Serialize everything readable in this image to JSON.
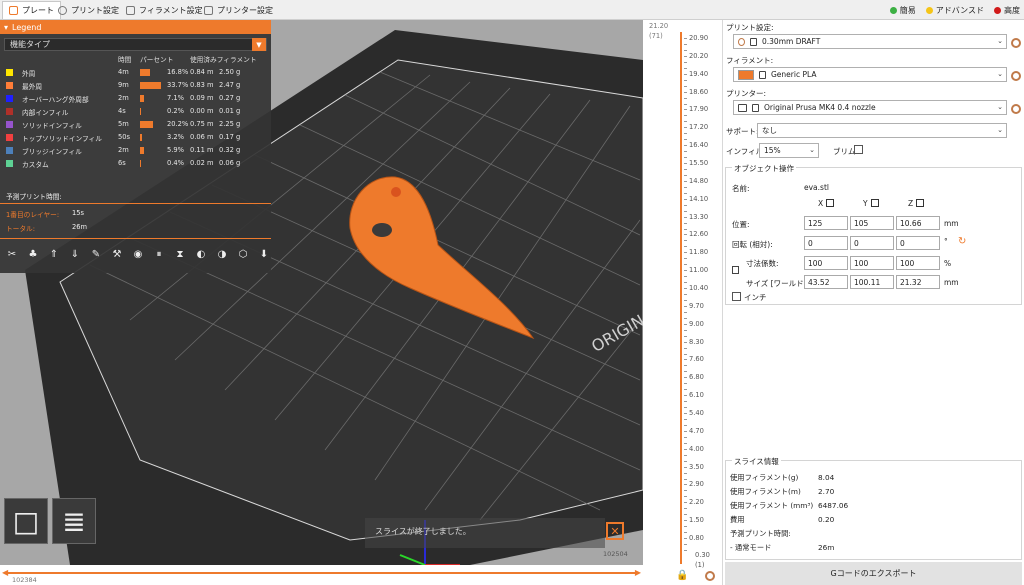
{
  "tabs": [
    {
      "label": "プレート",
      "active": true
    },
    {
      "label": "プリント設定",
      "active": false
    },
    {
      "label": "フィラメント設定",
      "active": false
    },
    {
      "label": "プリンター設定",
      "active": false
    }
  ],
  "modes": [
    {
      "label": "簡易",
      "color": "#3cb043"
    },
    {
      "label": "アドバンスド",
      "color": "#f5c518"
    },
    {
      "label": "高度",
      "color": "#d11a1a"
    }
  ],
  "legend": {
    "title": "Legend",
    "selector": "機能タイプ",
    "columns": {
      "time": "時間",
      "percent": "パーセント",
      "used": "使用済みフィラメント"
    },
    "rows": [
      {
        "name": "外周",
        "color": "#ffe600",
        "time": "4m",
        "percent": "16.8%",
        "pct": 0.168,
        "meters": "0.84 m",
        "grams": "2.50 g"
      },
      {
        "name": "最外周",
        "color": "#ff7d38",
        "time": "9m",
        "percent": "33.7%",
        "pct": 0.337,
        "meters": "0.83 m",
        "grams": "2.47 g"
      },
      {
        "name": "オーバーハング外周部",
        "color": "#1f1fff",
        "time": "2m",
        "percent": "7.1%",
        "pct": 0.071,
        "meters": "0.09 m",
        "grams": "0.27 g"
      },
      {
        "name": "内部インフィル",
        "color": "#b03029",
        "time": "4s",
        "percent": "0.2%",
        "pct": 0.002,
        "meters": "0.00 m",
        "grams": "0.01 g"
      },
      {
        "name": "ソリッドインフィル",
        "color": "#9654cc",
        "time": "5m",
        "percent": "20.2%",
        "pct": 0.202,
        "meters": "0.75 m",
        "grams": "2.25 g"
      },
      {
        "name": "トップソリッドインフィル",
        "color": "#f04040",
        "time": "50s",
        "percent": "3.2%",
        "pct": 0.032,
        "meters": "0.06 m",
        "grams": "0.17 g"
      },
      {
        "name": "ブリッジインフィル",
        "color": "#4d80ba",
        "time": "2m",
        "percent": "5.9%",
        "pct": 0.059,
        "meters": "0.11 m",
        "grams": "0.32 g"
      },
      {
        "name": "カスタム",
        "color": "#5ed194",
        "time": "6s",
        "percent": "0.4%",
        "pct": 0.004,
        "meters": "0.02 m",
        "grams": "0.06 g"
      }
    ],
    "estimated_title": "予測プリント時間:",
    "first_layer_label": "1番目のレイヤー:",
    "first_layer_value": "15s",
    "total_label": "トータル:",
    "total_value": "26m"
  },
  "toast": "スライスが終了しました。",
  "slider": {
    "top_height": "21.20",
    "top_layer": "(71)",
    "bottom_height": "0.30",
    "bottom_layer": "(1)",
    "ticks": [
      "20.90",
      "20.20",
      "19.40",
      "18.60",
      "17.90",
      "17.20",
      "16.40",
      "15.50",
      "14.80",
      "14.10",
      "13.30",
      "12.60",
      "11.80",
      "11.00",
      "10.40",
      "9.70",
      "9.00",
      "8.30",
      "7.60",
      "6.80",
      "6.10",
      "5.40",
      "4.70",
      "4.00",
      "3.50",
      "2.90",
      "2.20",
      "1.50",
      "0.80"
    ],
    "h_left": "102384",
    "h_right": "102504"
  },
  "panel": {
    "print_label": "プリント設定:",
    "print_value": "0.30mm DRAFT",
    "filament_label": "フィラメント:",
    "filament_value": "Generic PLA",
    "filament_color": "#ee7a2c",
    "printer_label": "プリンター:",
    "printer_value": "Original Prusa MK4 0.4 nozzle",
    "support_label": "サポート:",
    "support_value": "なし",
    "infill_label": "インフィル:",
    "infill_value": "15%",
    "brim_label": "ブリム:",
    "object_title": "オブジェクト操作",
    "name_label": "名前:",
    "name_value": "eva.stl",
    "axis_x": "X",
    "axis_y": "Y",
    "axis_z": "Z",
    "position_label": "位置:",
    "position": [
      "125",
      "105",
      "10.66"
    ],
    "position_unit": "mm",
    "rotation_label": "回転 (相対):",
    "rotation": [
      "0",
      "0",
      "0"
    ],
    "rotation_unit": "°",
    "scale_label": "寸法係数:",
    "scale": [
      "100",
      "100",
      "100"
    ],
    "scale_unit": "%",
    "size_label": "サイズ [ワールド]:",
    "size": [
      "43.52",
      "100.11",
      "21.32"
    ],
    "size_unit": "mm",
    "inch_label": "インチ",
    "slice_title": "スライス情報",
    "slice_rows": [
      {
        "label": "使用フィラメント(g)",
        "value": "8.04"
      },
      {
        "label": "使用フィラメント(m)",
        "value": "2.70"
      },
      {
        "label": "使用フィラメント (mm³)",
        "value": "6487.06"
      },
      {
        "label": "費用",
        "value": "0.20"
      },
      {
        "label": "予測プリント時間:",
        "value": ""
      },
      {
        "label": "- 通常モード",
        "value": "26m"
      }
    ],
    "export_label": "Gコードのエクスポート"
  }
}
